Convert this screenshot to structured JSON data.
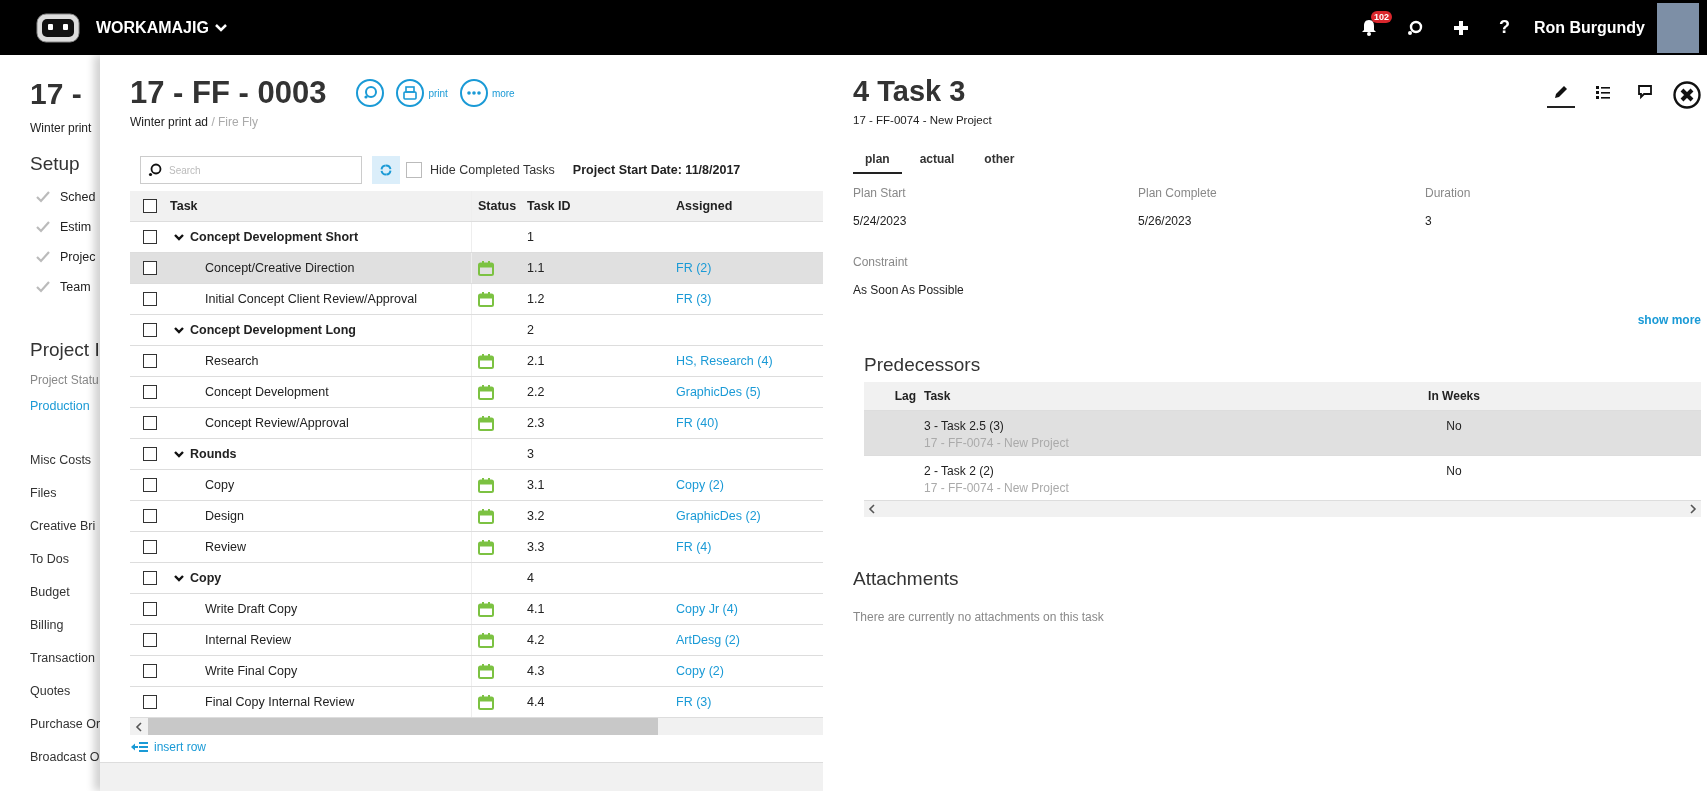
{
  "app": {
    "name": "WORKAMAJIG",
    "notifications": "102",
    "help": "?",
    "user": "Ron Burgundy"
  },
  "background_page": {
    "title": "17 -",
    "subtitle": "Winter print",
    "setup_heading": "Setup",
    "setup_items": [
      {
        "label": "Sched",
        "checked": true
      },
      {
        "label": "Estim",
        "checked": true
      },
      {
        "label": "Projec",
        "checked": true
      },
      {
        "label": "Team",
        "checked": true
      }
    ],
    "section_heading": "Project I",
    "status_label": "Project Statu",
    "status_value": "Production",
    "nav_items": [
      "Misc Costs",
      "Files",
      "Creative Bri",
      "To Dos",
      "Budget",
      "Billing",
      "Transaction",
      "Quotes",
      "Purchase Or",
      "Broadcast O"
    ]
  },
  "project": {
    "title": "17 - FF - 0003",
    "client": "Winter print ad",
    "brand": "/ Fire Fly",
    "actions": [
      {
        "kind": "search"
      },
      {
        "kind": "print",
        "label": "print"
      },
      {
        "kind": "more",
        "label": "more"
      }
    ]
  },
  "toolbar": {
    "search_placeholder": "Search",
    "hide_completed": {
      "label": "Hide Completed Tasks",
      "checked": false
    },
    "start_date": "Project Start Date: 11/8/2017"
  },
  "table": {
    "columns": [
      "Task",
      "Status",
      "Task ID",
      "Assigned"
    ],
    "all_checked": false,
    "groups": [
      {
        "task": "Concept Development Short",
        "task_id": "1",
        "expanded": true,
        "checked": false,
        "selected": false,
        "children": [
          {
            "task": "Concept/Creative Direction",
            "task_id": "1.1",
            "assigned": "FR (2)",
            "checked": false,
            "selected": true
          },
          {
            "task": "Initial Concept Client Review/Approval",
            "task_id": "1.2",
            "assigned": "FR (3)",
            "checked": false,
            "selected": false
          }
        ]
      },
      {
        "task": "Concept Development Long",
        "task_id": "2",
        "expanded": true,
        "checked": false,
        "selected": false,
        "children": [
          {
            "task": "Research",
            "task_id": "2.1",
            "assigned": "HS, Research (4)",
            "checked": false,
            "selected": false
          },
          {
            "task": "Concept Development",
            "task_id": "2.2",
            "assigned": "GraphicDes (5)",
            "checked": false,
            "selected": false
          },
          {
            "task": "Concept Review/Approval",
            "task_id": "2.3",
            "assigned": "FR (40)",
            "checked": false,
            "selected": false
          }
        ]
      },
      {
        "task": "Rounds",
        "task_id": "3",
        "expanded": true,
        "checked": false,
        "selected": false,
        "children": [
          {
            "task": "Copy",
            "task_id": "3.1",
            "assigned": "Copy (2)",
            "checked": false,
            "selected": false
          },
          {
            "task": "Design",
            "task_id": "3.2",
            "assigned": "GraphicDes (2)",
            "checked": false,
            "selected": false
          },
          {
            "task": "Review",
            "task_id": "3.3",
            "assigned": "FR (4)",
            "checked": false,
            "selected": false
          }
        ]
      },
      {
        "task": "Copy",
        "task_id": "4",
        "expanded": true,
        "checked": false,
        "selected": false,
        "children": [
          {
            "task": "Write Draft Copy",
            "task_id": "4.1",
            "assigned": "Copy Jr (4)",
            "checked": false,
            "selected": false
          },
          {
            "task": "Internal Review",
            "task_id": "4.2",
            "assigned": "ArtDesg (2)",
            "checked": false,
            "selected": false
          },
          {
            "task": "Write Final Copy",
            "task_id": "4.3",
            "assigned": "Copy (2)",
            "checked": false,
            "selected": false
          },
          {
            "task": "Final Copy Internal Review",
            "task_id": "4.4",
            "assigned": "FR (3)",
            "checked": false,
            "selected": false
          }
        ]
      }
    ]
  },
  "insert_row": "insert row",
  "detail": {
    "title": "4 Task 3",
    "subtitle": "17 - FF-0074 - New Project",
    "tools": [
      {
        "kind": "edit",
        "selected": true
      },
      {
        "kind": "list",
        "selected": false
      },
      {
        "kind": "comment",
        "selected": false
      }
    ],
    "tabs": [
      {
        "label": "plan",
        "selected": true
      },
      {
        "label": "actual",
        "selected": false
      },
      {
        "label": "other",
        "selected": false
      }
    ],
    "fields": [
      {
        "label": "Plan Start",
        "value": "5/24/2023"
      },
      {
        "label": "Plan Complete",
        "value": "5/26/2023"
      },
      {
        "label": "Duration",
        "value": "3"
      },
      {
        "label": "Constraint",
        "value": "As Soon As Possible"
      }
    ],
    "show_more": "show more",
    "predecessors": {
      "heading": "Predecessors",
      "columns": [
        "Lag",
        "Task",
        "In Weeks"
      ],
      "rows": [
        {
          "task": "3 - Task 2.5 (3)",
          "project": "17 - FF-0074 - New Project",
          "in_weeks": "No",
          "selected": true
        },
        {
          "task": "2 - Task 2 (2)",
          "project": "17 - FF-0074 - New Project",
          "in_weeks": "No",
          "selected": false
        }
      ]
    },
    "attachments": {
      "heading": "Attachments",
      "empty_text": "There are currently no attachments on this task"
    }
  }
}
